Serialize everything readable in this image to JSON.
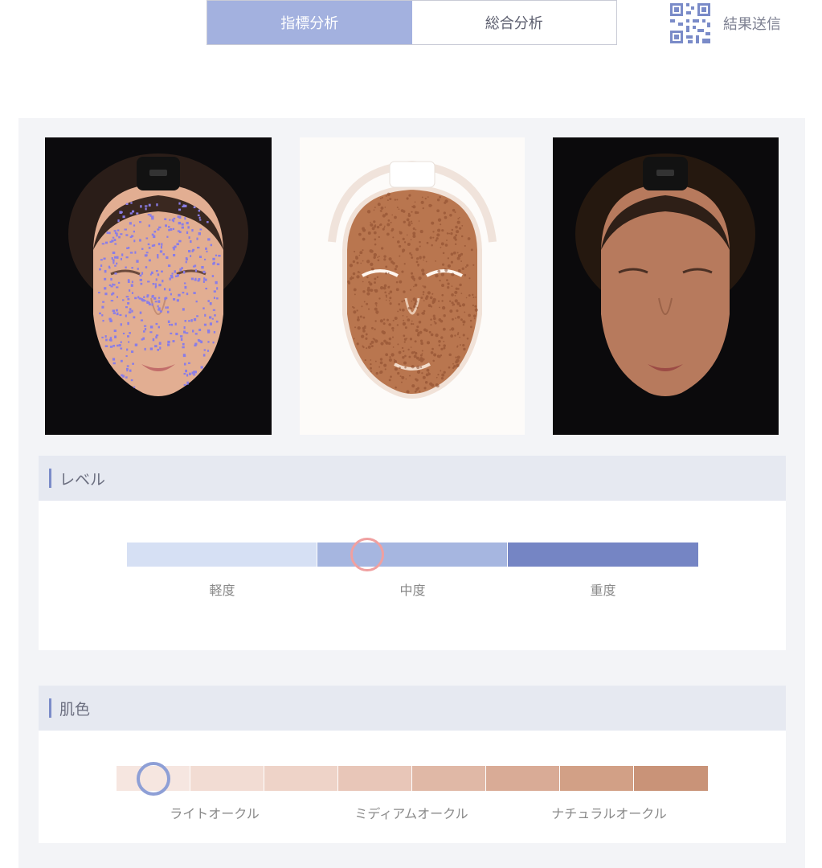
{
  "tabs": [
    {
      "label": "指標分析",
      "active": true
    },
    {
      "label": "総合分析",
      "active": false
    }
  ],
  "send_result": {
    "label": "結果送信",
    "icon": "qr-code-icon"
  },
  "level_section": {
    "title": "レベル",
    "segments": [
      {
        "label": "軽度",
        "color": "#d6e0f4"
      },
      {
        "label": "中度",
        "color": "#a6b6e0"
      },
      {
        "label": "重度",
        "color": "#7585c4"
      }
    ],
    "marker_position": 0.42,
    "marker_color": "#f0a0a0"
  },
  "skin_section": {
    "title": "肌色",
    "swatches": [
      "#f6e6e0",
      "#f2dcd3",
      "#eed3c8",
      "#e8c6b8",
      "#e0b8a6",
      "#d9ab96",
      "#d2a086",
      "#c99378"
    ],
    "labels": [
      "ライトオークル",
      "ミディアムオークル",
      "ナチュラルオークル"
    ],
    "marker_index": 0.5,
    "marker_color": "#8e9fd6"
  },
  "colors": {
    "accent": "#a3b1df",
    "section_header": "#e6e9f1"
  }
}
